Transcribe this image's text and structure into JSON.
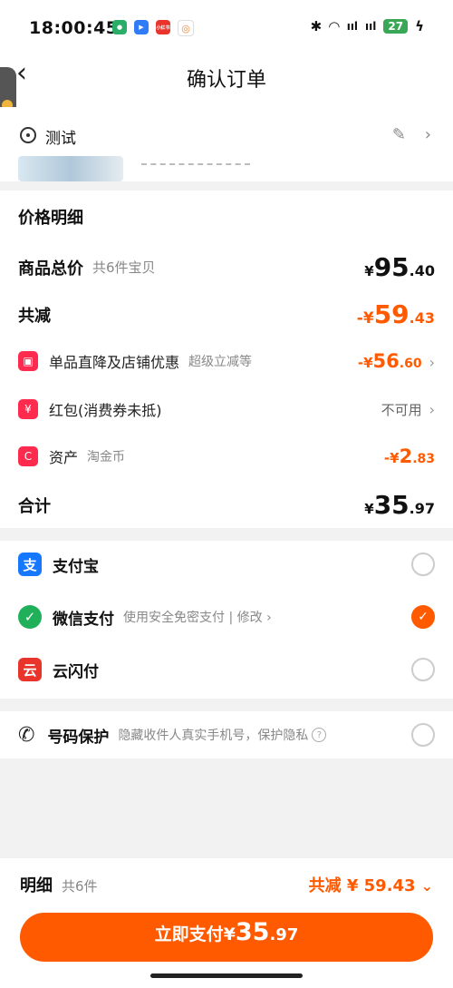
{
  "status": {
    "time": "18:00:45",
    "apps": [
      {
        "name": "wechat-app-icon",
        "color": "#2aae67",
        "text": "●"
      },
      {
        "name": "blue-app-icon",
        "color": "#2f7cf6",
        "text": "▶"
      },
      {
        "name": "red-app-icon",
        "color": "#e8342b",
        "text": "小红书"
      },
      {
        "name": "color-app-icon",
        "color": "#ffffff",
        "text": "◎"
      }
    ],
    "battery": "27"
  },
  "nav": {
    "back": "‹",
    "title": "确认订单"
  },
  "address": {
    "label": "测试",
    "edit": "✎",
    "chevron": "›"
  },
  "price": {
    "section_title": "价格明细",
    "goods_label": "商品总价",
    "goods_count": "共6件宝贝",
    "goods_currency": "¥",
    "goods_int": "95",
    "goods_dec": ".40",
    "discount_label": "共减",
    "discount_prefix": "-¥",
    "discount_int": "59",
    "discount_dec": ".43",
    "items": [
      {
        "icon": "▣",
        "label": "单品直降及店铺优惠",
        "sub": "超级立减等",
        "prefix": "-¥",
        "int": "56",
        "dec": ".60",
        "plain": "",
        "chev": "›"
      },
      {
        "icon": "¥",
        "label": "红包(消费券未抵)",
        "sub": "",
        "prefix": "",
        "int": "",
        "dec": "",
        "plain": "不可用",
        "chev": "›"
      },
      {
        "icon": "C",
        "label": "资产",
        "sub": "淘金币",
        "prefix": "-¥",
        "int": "2",
        "dec": ".83",
        "plain": "",
        "chev": ""
      }
    ],
    "total_label": "合计",
    "total_currency": "¥",
    "total_int": "35",
    "total_dec": ".97"
  },
  "payment": {
    "options": [
      {
        "icon": "支",
        "icon_color": "#1677ff",
        "label": "支付宝",
        "sub": "",
        "selected": false
      },
      {
        "icon": "✓",
        "icon_color": "#20b05a",
        "label": "微信支付",
        "sub": "使用安全免密支付 | 修改 ›",
        "selected": true
      },
      {
        "icon": "云",
        "icon_color": "#e8342b",
        "label": "云闪付",
        "sub": "",
        "selected": false
      }
    ]
  },
  "protect": {
    "label": "号码保护",
    "desc": "隐藏收件人真实手机号，保护隐私",
    "help": "?"
  },
  "bottom": {
    "detail_label": "明细",
    "detail_count": "共6件",
    "discount_text": "共减 ¥ 59.43",
    "expand": "⌄",
    "pay_label": "立即支付¥",
    "pay_int": "35",
    "pay_dec": ".97"
  },
  "colors": {
    "accent": "#ff5a00",
    "brand_red": "#ff2b4f"
  }
}
